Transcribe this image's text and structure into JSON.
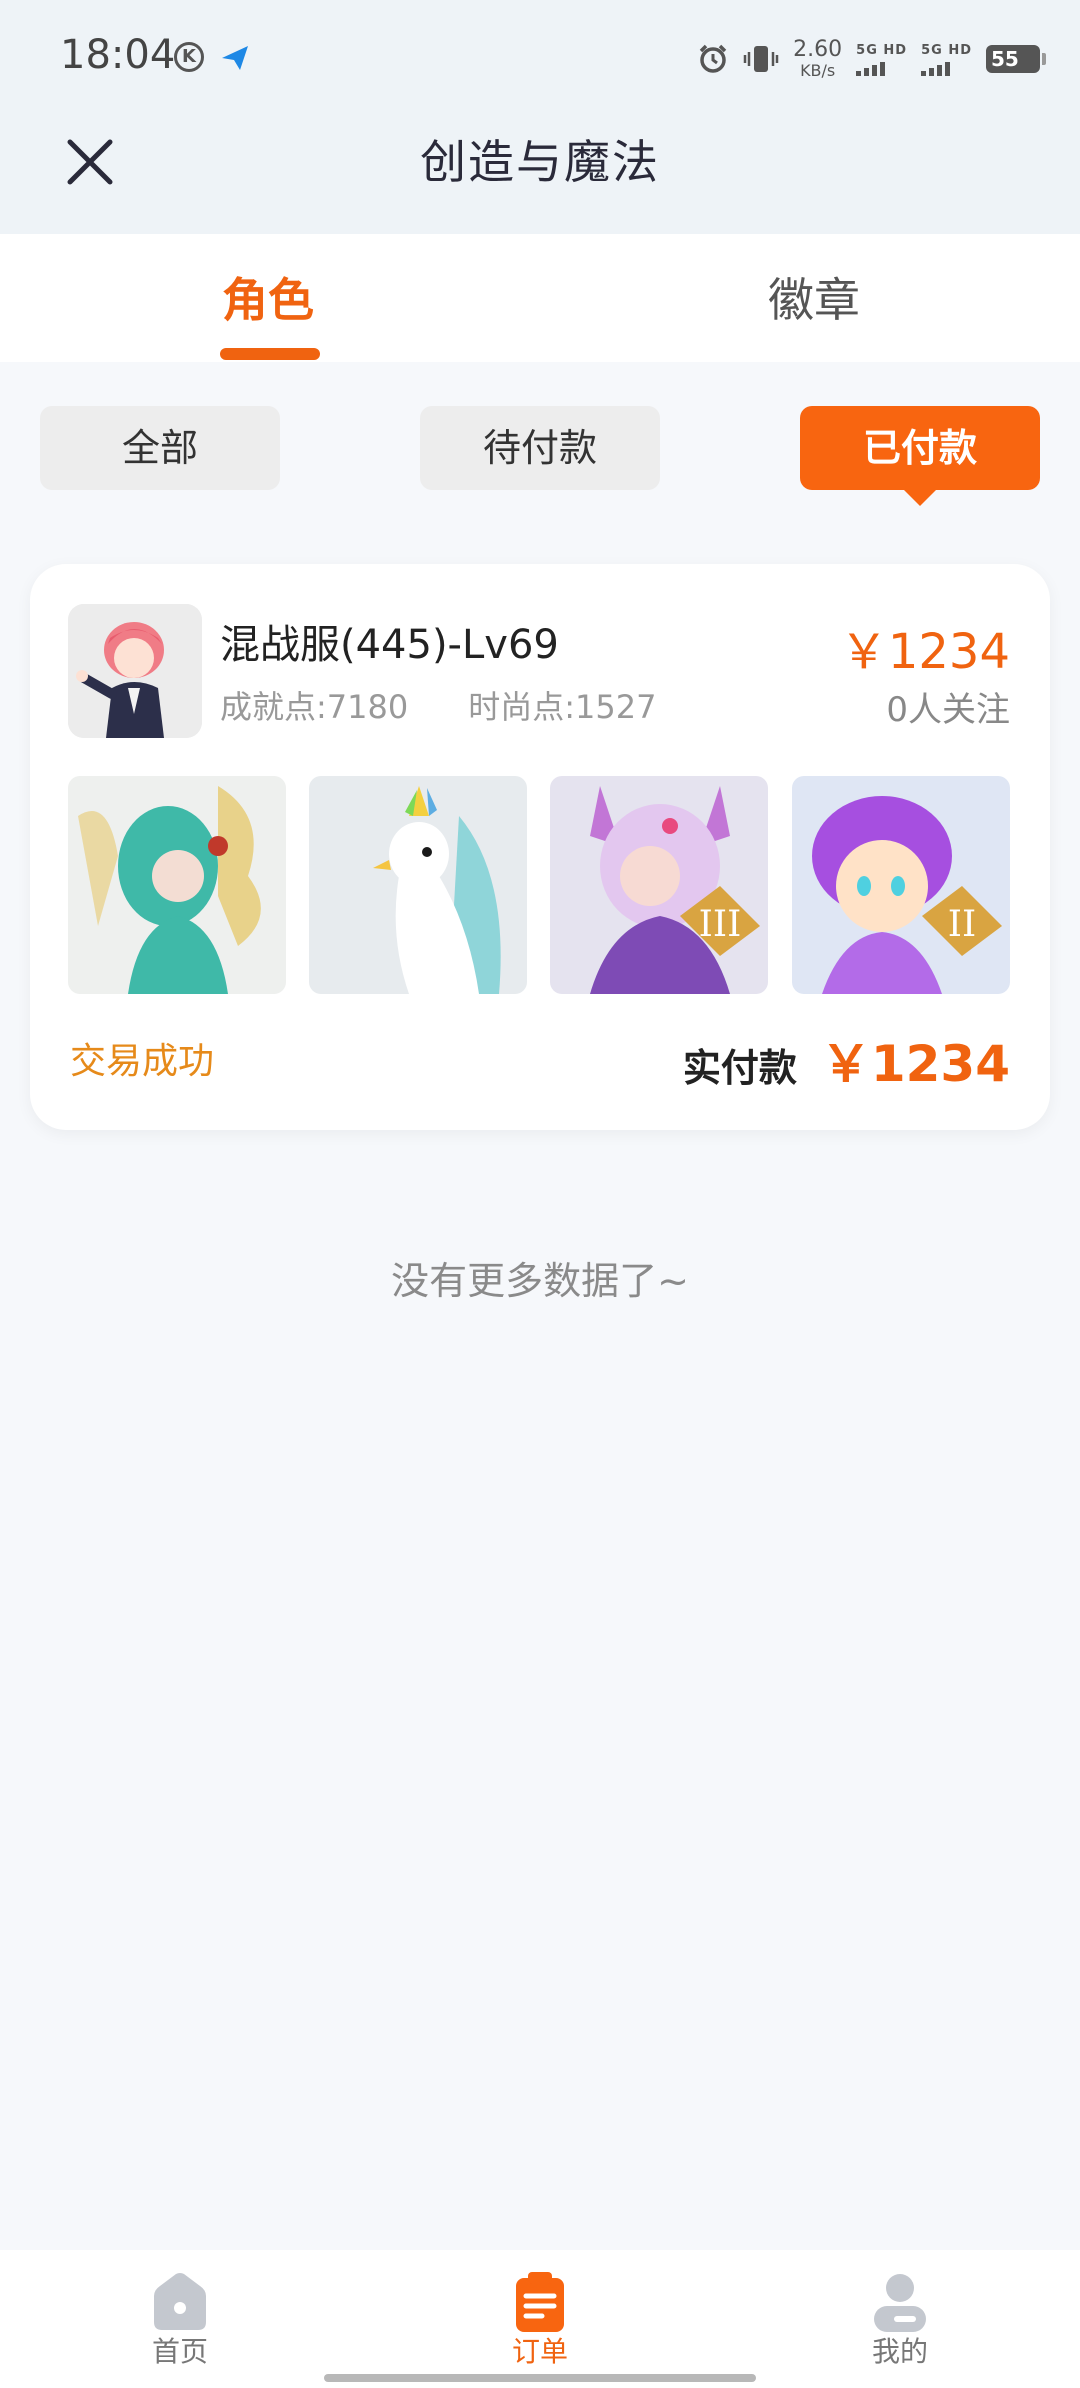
{
  "status_bar": {
    "time": "18:04",
    "k_badge": "K",
    "net_speed_value": "2.60",
    "net_speed_unit": "KB/s",
    "sim1_label": "5G HD",
    "sim2_label": "5G HD",
    "battery": "55"
  },
  "header": {
    "title": "创造与魔法"
  },
  "tabs": [
    {
      "label": "角色",
      "active": true
    },
    {
      "label": "徽章",
      "active": false
    }
  ],
  "filters": [
    {
      "label": "全部",
      "active": false
    },
    {
      "label": "待付款",
      "active": false
    },
    {
      "label": "已付款",
      "active": true
    }
  ],
  "order": {
    "name": "混战服(445)-Lv69",
    "achievement": "成就点:7180",
    "fashion": "时尚点:1527",
    "price": "￥1234",
    "followers": "0人关注",
    "thumb_badges": [
      "III",
      "II"
    ],
    "status": "交易成功",
    "paid_label": "实付款",
    "paid_amount": "￥1234"
  },
  "no_more_text": "没有更多数据了~",
  "bottom_nav": [
    {
      "label": "首页",
      "icon": "home-icon",
      "active": false
    },
    {
      "label": "订单",
      "icon": "orders-icon",
      "active": true
    },
    {
      "label": "我的",
      "icon": "profile-icon",
      "active": false
    }
  ],
  "colors": {
    "accent": "#f06310",
    "status": "#e68a1a",
    "background": "#f6f8fb"
  }
}
